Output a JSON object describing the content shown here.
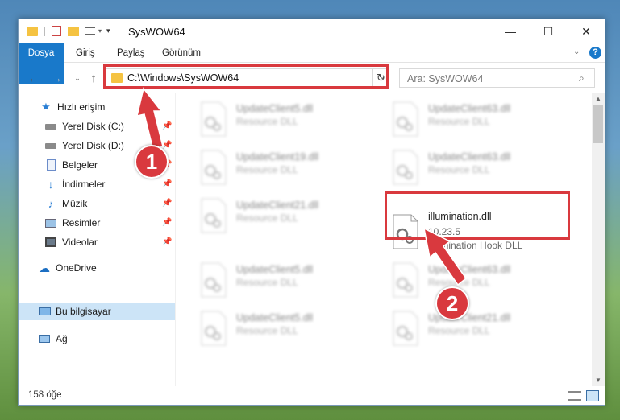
{
  "window": {
    "title": "SysWOW64",
    "minimize": "—",
    "maximize": "☐",
    "close": "✕"
  },
  "ribbon": {
    "tabs": [
      "Dosya",
      "Giriş",
      "Paylaş",
      "Görünüm"
    ]
  },
  "address": {
    "path": "C:\\Windows\\SysWOW64",
    "search_placeholder": "Ara: SysWOW64"
  },
  "nav": {
    "quick_access": "Hızlı erişim",
    "items": [
      {
        "label": "Yerel Disk (C:)",
        "icon": "drive-icon",
        "pinned": true
      },
      {
        "label": "Yerel Disk (D:)",
        "icon": "drive-icon",
        "pinned": true
      },
      {
        "label": "Belgeler",
        "icon": "documents-icon",
        "pinned": true
      },
      {
        "label": "İndirmeler",
        "icon": "downloads-icon",
        "pinned": true
      },
      {
        "label": "Müzik",
        "icon": "music-icon",
        "pinned": true
      },
      {
        "label": "Resimler",
        "icon": "pictures-icon",
        "pinned": true
      },
      {
        "label": "Videolar",
        "icon": "videos-icon",
        "pinned": true
      }
    ],
    "onedrive": "OneDrive",
    "this_pc": "Bu bilgisayar",
    "network": "Ağ"
  },
  "files": [
    {
      "name": "UpdateClient5.dll",
      "desc": "Resource DLL",
      "blurred": true
    },
    {
      "name": "UpdateClient63.dll",
      "desc": "Resource DLL",
      "blurred": true
    },
    {
      "name": "UpdateClient19.dll",
      "desc": "Resource DLL",
      "blurred": true
    },
    {
      "name": "UpdateClient63.dll",
      "desc": "Resource DLL",
      "blurred": true
    },
    {
      "name": "UpdateClient21.dll",
      "desc": "Resource DLL",
      "blurred": true
    },
    {
      "name": "illumination.dll",
      "desc": "10.23.5",
      "desc2": "Illumination Hook DLL",
      "blurred": false
    },
    {
      "name": "UpdateClient5.dll",
      "desc": "Resource DLL",
      "blurred": true
    },
    {
      "name": "UpdateClient63.dll",
      "desc": "Resource DLL",
      "blurred": true
    },
    {
      "name": "UpdateClient5.dll",
      "desc": "Resource DLL",
      "blurred": true
    },
    {
      "name": "UpdateClient21.dll",
      "desc": "Resource DLL",
      "blurred": true
    }
  ],
  "status": {
    "count": "158 öğe"
  },
  "annotations": {
    "step1": "1",
    "step2": "2",
    "color": "#d9393e"
  },
  "colors": {
    "accent": "#1979ca",
    "selected": "#cce4f7",
    "folder": "#f5c342"
  }
}
